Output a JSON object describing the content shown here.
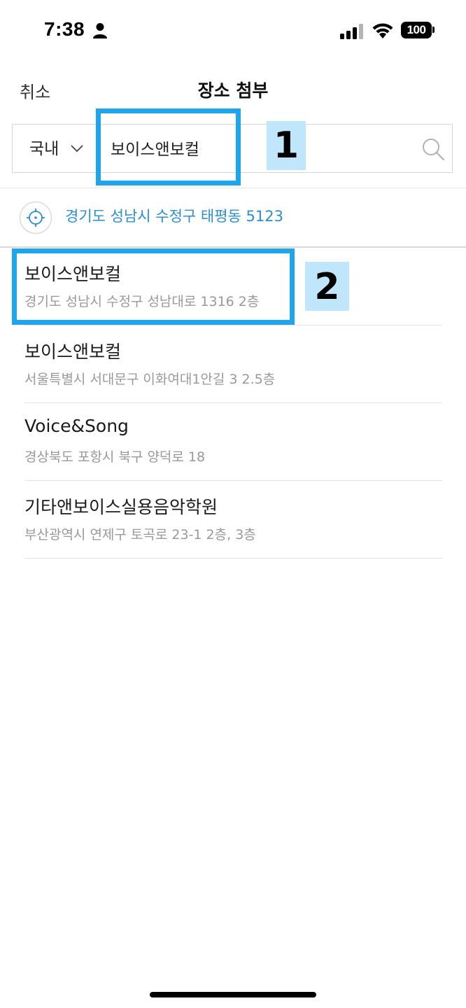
{
  "status_bar": {
    "time": "7:38",
    "battery": "100",
    "icons": [
      "person-icon",
      "signal-icon",
      "wifi-icon",
      "battery-icon"
    ]
  },
  "header": {
    "cancel_label": "취소",
    "title": "장소 첨부"
  },
  "search": {
    "region_label": "국내",
    "query": "보이스앤보컬",
    "icons": [
      "chevron-down-icon",
      "search-icon"
    ]
  },
  "current_location": {
    "address": "경기도 성남시 수정구 태평동 5123",
    "icon": "crosshair-location-icon"
  },
  "results": [
    {
      "name": "보이스앤보컬",
      "address": "경기도 성남시 수정구 성남대로 1316 2층"
    },
    {
      "name": "보이스앤보컬",
      "address": "서울특별시 서대문구 이화여대1안길 3 2.5층"
    },
    {
      "name": "Voice&Song",
      "address": "경상북도 포항시 북구 양덕로 18"
    },
    {
      "name": "기타앤보이스실용음악학원",
      "address": "부산광역시 연제구 토곡로 23-1 2층, 3층"
    }
  ],
  "annotations": {
    "label_1": "1",
    "label_2": "2",
    "color": "#1ea5ec",
    "label_bg": "#bfe6fb"
  },
  "colors": {
    "location_text": "#2a8fd3",
    "address_text": "#999999"
  }
}
